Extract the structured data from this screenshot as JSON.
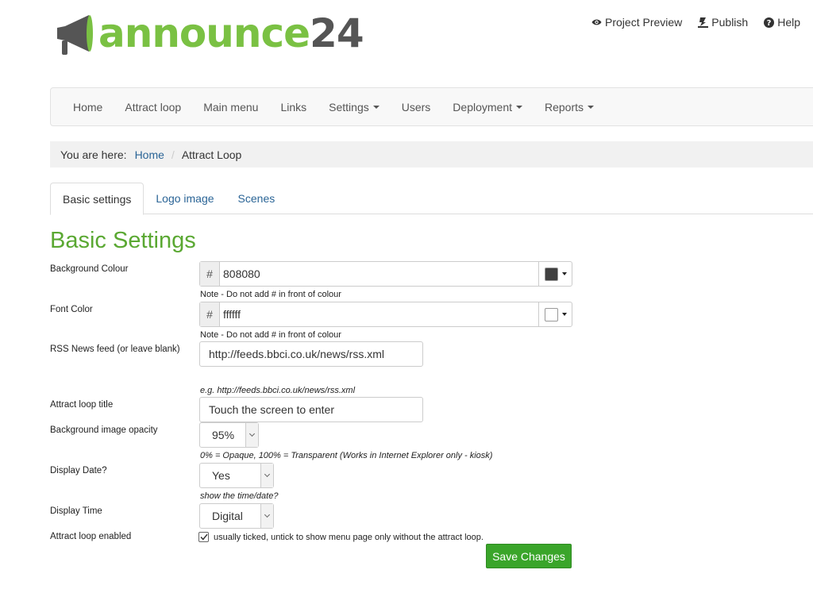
{
  "brand": {
    "logo_part1": "announce",
    "logo_part2": "24",
    "accent_color": "#7ac143"
  },
  "top_links": [
    {
      "label": "Project Preview",
      "icon": "eye-icon"
    },
    {
      "label": "Publish",
      "icon": "publish-icon"
    },
    {
      "label": "Help",
      "icon": "question-icon"
    }
  ],
  "nav": [
    {
      "label": "Home"
    },
    {
      "label": "Attract loop"
    },
    {
      "label": "Main menu"
    },
    {
      "label": "Links"
    },
    {
      "label": "Settings",
      "dropdown": true
    },
    {
      "label": "Users"
    },
    {
      "label": "Deployment",
      "dropdown": true
    },
    {
      "label": "Reports",
      "dropdown": true
    }
  ],
  "breadcrumb": {
    "prefix": "You are here:",
    "home": "Home",
    "separator": "/",
    "current": "Attract Loop"
  },
  "tabs": [
    {
      "label": "Basic settings",
      "active": true
    },
    {
      "label": "Logo image"
    },
    {
      "label": "Scenes"
    }
  ],
  "heading": "Basic Settings",
  "form": {
    "bg_colour": {
      "label": "Background Colour",
      "hash": "#",
      "value": "808080",
      "swatch_color": "#404040",
      "note": "Note - Do not add # in front of colour"
    },
    "font_color": {
      "label": "Font Color",
      "hash": "#",
      "value": "ffffff",
      "swatch_color": "#ffffff",
      "note": "Note - Do not add # in front of colour"
    },
    "rss": {
      "label": "RSS News feed (or leave blank)",
      "value": "http://feeds.bbci.co.uk/news/rss.xml",
      "note": "e.g. http://feeds.bbci.co.uk/news/rss.xml"
    },
    "title": {
      "label": "Attract loop title",
      "value": "Touch the screen to enter"
    },
    "opacity": {
      "label": "Background image opacity",
      "value": "95%",
      "note": "0% = Opaque, 100% = Transparent (Works in Internet Explorer only - kiosk)"
    },
    "display_date": {
      "label": "Display Date?",
      "value": "Yes",
      "note": "show the time/date?"
    },
    "display_time": {
      "label": "Display Time",
      "value": "Digital"
    },
    "enabled": {
      "label": "Attract loop enabled",
      "checked": true,
      "note": "usually ticked, untick to show menu page only without the attract loop."
    },
    "save_label": "Save Changes"
  }
}
